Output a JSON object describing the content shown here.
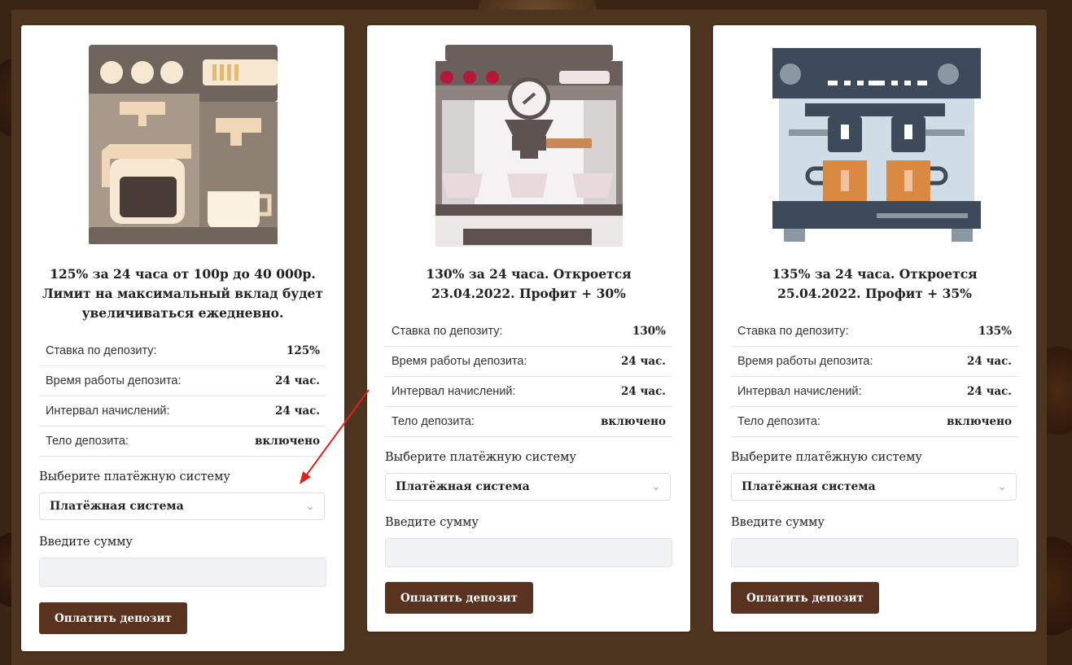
{
  "cards": [
    {
      "title": "125% за 24 часа от 100р до 40 000р. Лимит на максимальный вклад будет увеличиваться ежедневно.",
      "specs": [
        {
          "label": "Ставка по депозиту:",
          "value": "125%"
        },
        {
          "label": "Время работы депозита:",
          "value": "24 час."
        },
        {
          "label": "Интервал начислений:",
          "value": "24 час."
        },
        {
          "label": "Тело депозита:",
          "value": "включено"
        }
      ],
      "payment_label": "Выберите платёжную систему",
      "payment_select": "Платёжная система",
      "amount_label": "Введите сумму",
      "pay_button": "Оплатить депозит"
    },
    {
      "title": "130% за 24 часа. Откроется 23.04.2022. Профит + 30%",
      "specs": [
        {
          "label": "Ставка по депозиту:",
          "value": "130%"
        },
        {
          "label": "Время работы депозита:",
          "value": "24 час."
        },
        {
          "label": "Интервал начислений:",
          "value": "24 час."
        },
        {
          "label": "Тело депозита:",
          "value": "включено"
        }
      ],
      "payment_label": "Выберите платёжную систему",
      "payment_select": "Платёжная система",
      "amount_label": "Введите сумму",
      "pay_button": "Оплатить депозит"
    },
    {
      "title": "135% за 24 часа. Откроется 25.04.2022. Профит + 35%",
      "specs": [
        {
          "label": "Ставка по депозиту:",
          "value": "135%"
        },
        {
          "label": "Время работы депозита:",
          "value": "24 час."
        },
        {
          "label": "Интервал начислений:",
          "value": "24 час."
        },
        {
          "label": "Тело депозита:",
          "value": "включено"
        }
      ],
      "payment_label": "Выберите платёжную систему",
      "payment_select": "Платёжная система",
      "amount_label": "Введите сумму",
      "pay_button": "Оплатить депозит"
    }
  ],
  "colors": {
    "accent_button": "#5a3320",
    "annotation_arrow": "#e3211c"
  }
}
